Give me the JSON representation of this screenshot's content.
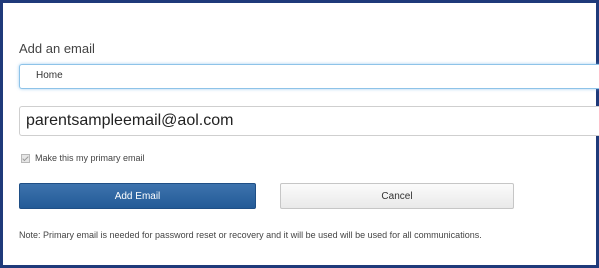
{
  "form": {
    "heading": "Add an email",
    "type_value": "Home",
    "email_value": "parentsampleemail@aol.com",
    "primary_label": "Make this my primary email",
    "primary_checked": true,
    "add_label": "Add Email",
    "cancel_label": "Cancel",
    "note": "Note: Primary email is needed for password reset or recovery and it will be used will be used for all communications."
  },
  "colors": {
    "frame_border": "#1f3a7a",
    "primary_button": "#2a629e",
    "focus_border": "#8ec3e8"
  }
}
